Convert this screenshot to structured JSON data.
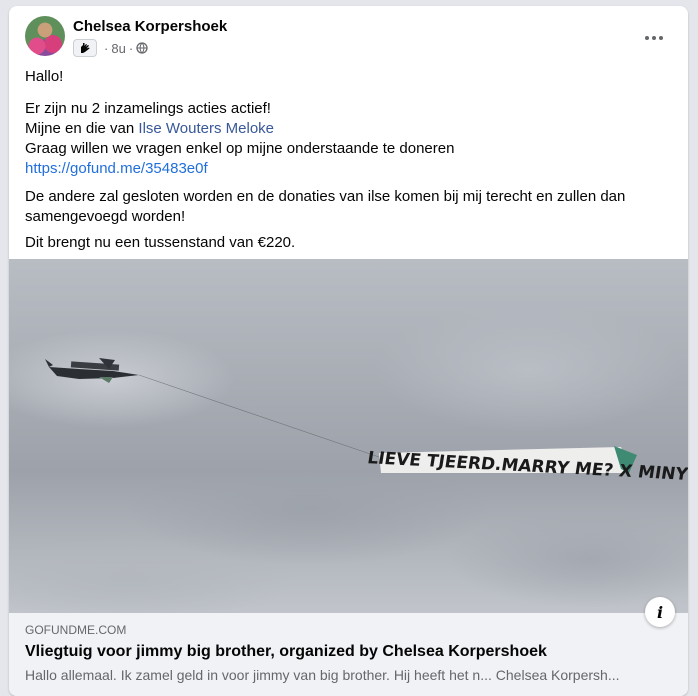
{
  "post": {
    "author": "Chelsea Korpershoek",
    "time": "8u",
    "separator": "·",
    "privacy_icon": "globe-icon",
    "group_icon": "hand-wave-icon",
    "more_icon": "more-dots-icon",
    "text": {
      "greeting": "Hallo!",
      "line1": "Er zijn nu 2 inzamelings acties actief!",
      "line2_prefix": "Mijne en die van ",
      "line2_link": "Ilse Wouters Meloke",
      "line3": "Graag willen we vragen enkel op mijne onderstaande te doneren",
      "url": "https://gofund.me/35483e0f",
      "paragraph2": "De andere zal gesloten worden en de donaties van ilse komen bij mij terecht en zullen dan samengevoegd worden!",
      "paragraph3": "Dit brengt nu een tussenstand van €220."
    }
  },
  "photo": {
    "banner_text": "LIEVE TJEERD.MARRY ME? X MINY"
  },
  "link_preview": {
    "domain": "GOFUNDME.COM",
    "title": "Vliegtuig voor jimmy big brother, organized by Chelsea Korpershoek",
    "description": "Hallo allemaal. Ik zamel geld in voor jimmy van big brother. Hij heeft het n... Chelsea Korpersh...",
    "info_icon": "info-icon"
  },
  "colors": {
    "link": "#385898",
    "url": "#216fdb",
    "background": "#e4e6eb",
    "preview_bg": "#f0f2f5",
    "secondary_text": "#65676b"
  }
}
